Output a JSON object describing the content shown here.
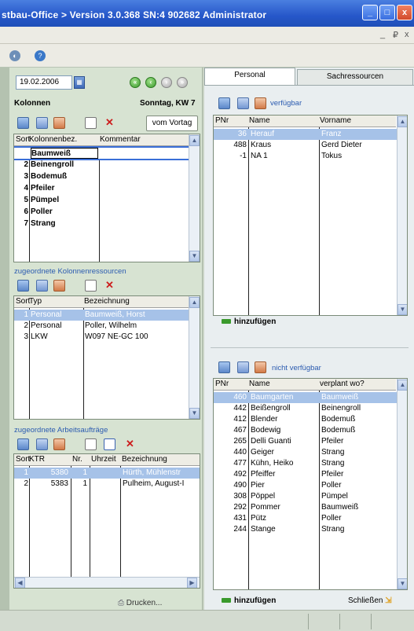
{
  "window": {
    "title": "stbau-Office > Version 3.0.368 SN:4 902682 Administrator",
    "min": "_",
    "max": "□",
    "close": "x"
  },
  "mdi": {
    "min": "_",
    "restore": "₽",
    "close": "x"
  },
  "left": {
    "date": "19.02.2006",
    "kolonnen_label": "Kolonnen",
    "day_label": "Sonntag, KW 7",
    "vom_vortag": "vom Vortag",
    "kolonnen_grid": {
      "headers": [
        "Sort",
        "Kolonnenbez.",
        "Kommentar"
      ],
      "rows": [
        [
          "",
          "Baumweiß",
          ""
        ],
        [
          "2",
          "Beinengroll",
          ""
        ],
        [
          "3",
          "Bodemuß",
          ""
        ],
        [
          "4",
          "Pfeiler",
          ""
        ],
        [
          "5",
          "Pümpel",
          ""
        ],
        [
          "6",
          "Poller",
          ""
        ],
        [
          "7",
          "Strang",
          ""
        ]
      ]
    },
    "ressourcen_section": "zugeordnete Kolonnenressourcen",
    "ressourcen_grid": {
      "headers": [
        "Sort",
        "Typ",
        "Bezeichnung"
      ],
      "rows": [
        [
          "1",
          "Personal",
          "Baumweiß, Horst"
        ],
        [
          "2",
          "Personal",
          "Poller, Wilhelm"
        ],
        [
          "3",
          "LKW",
          "W097 NE-GC 100"
        ]
      ]
    },
    "auftraege_section": "zugeordnete Arbeitsaufträge",
    "auftraege_grid": {
      "headers": [
        "Sort",
        "KTR",
        "Nr.",
        "Uhrzeit",
        "Bezeichnung"
      ],
      "rows": [
        [
          "1",
          "5380",
          "1",
          "",
          "Hürth, Mühlenstr"
        ],
        [
          "2",
          "5383",
          "1",
          "",
          "Pulheim, August-I"
        ]
      ]
    },
    "drucken": "Drucken..."
  },
  "right": {
    "tabs": [
      "Personal",
      "Sachressourcen"
    ],
    "verfuegbar_label": "verfügbar",
    "verfuegbar_grid": {
      "headers": [
        "PNr",
        "Name",
        "Vorname"
      ],
      "rows": [
        [
          "36",
          "Herauf",
          "Franz"
        ],
        [
          "488",
          "Kraus",
          "Gerd Dieter"
        ],
        [
          "-1",
          "NA 1",
          "Tokus"
        ]
      ]
    },
    "hinzufuegen1": "hinzufügen",
    "nicht_verfuegbar_label": "nicht verfügbar",
    "nicht_grid": {
      "headers": [
        "PNr",
        "Name",
        "verplant wo?"
      ],
      "rows": [
        [
          "460",
          "Baumgarten",
          "Baumweiß"
        ],
        [
          "442",
          "Beißengroll",
          "Beinengroll"
        ],
        [
          "412",
          "Blender",
          "Bodemuß"
        ],
        [
          "467",
          "Bodewig",
          "Bodemuß"
        ],
        [
          "265",
          "Delli Guanti",
          "Pfeiler"
        ],
        [
          "440",
          "Geiger",
          "Strang"
        ],
        [
          "477",
          "Kühn, Heiko",
          "Strang"
        ],
        [
          "492",
          "Pfeiffer",
          "Pfeiler"
        ],
        [
          "490",
          "Pier",
          "Poller"
        ],
        [
          "308",
          "Pöppel",
          "Pümpel"
        ],
        [
          "292",
          "Pommer",
          "Baumweiß"
        ],
        [
          "431",
          "Pütz",
          "Poller"
        ],
        [
          "244",
          "Stange",
          "Strang"
        ]
      ]
    },
    "hinzufuegen2": "hinzufügen",
    "schliessen": "Schließen"
  }
}
